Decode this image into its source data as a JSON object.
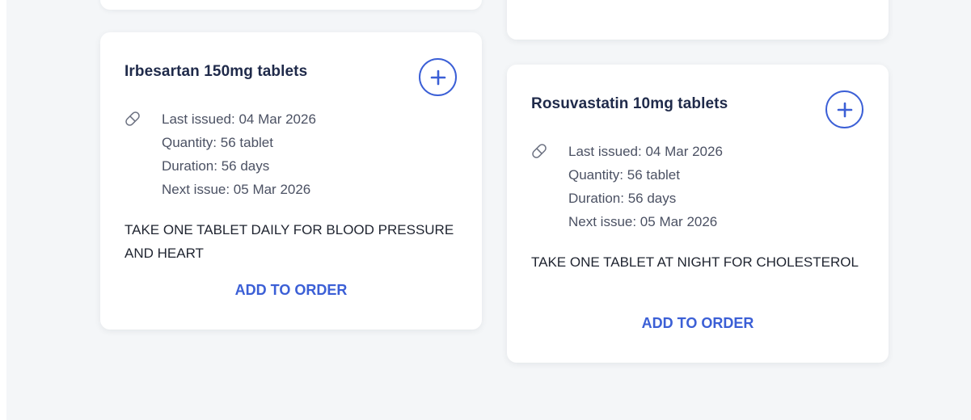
{
  "medications": [
    {
      "name": "Irbesartan 150mg tablets",
      "last_issued": "Last issued: 04 Mar 2026",
      "quantity": "Quantity: 56 tablet",
      "duration": "Duration: 56 days",
      "next_issue": "Next issue: 05 Mar 2026",
      "instructions": "TAKE ONE TABLET DAILY FOR BLOOD PRESSURE AND HEART",
      "action_label": "ADD TO ORDER",
      "add_icon": "plus-circle-icon",
      "item_icon": "pill-icon"
    },
    {
      "name": "Rosuvastatin 10mg tablets",
      "last_issued": "Last issued: 04 Mar 2026",
      "quantity": "Quantity: 56 tablet",
      "duration": "Duration: 56 days",
      "next_issue": "Next issue: 05 Mar 2026",
      "instructions": "TAKE ONE TABLET AT NIGHT FOR CHOLESTEROL",
      "action_label": "ADD TO ORDER",
      "add_icon": "plus-circle-icon",
      "item_icon": "pill-icon"
    }
  ],
  "colors": {
    "accent": "#3b5fd6",
    "title": "#1f2a4a",
    "detail_text": "#4b5163",
    "background": "#f4f6f8",
    "card": "#ffffff"
  }
}
